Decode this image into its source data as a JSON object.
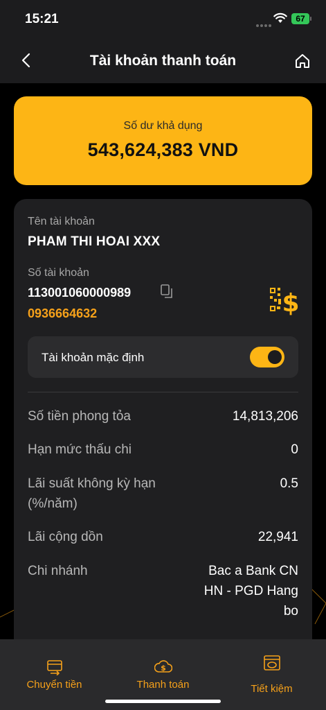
{
  "status_bar": {
    "time": "15:21",
    "battery": "67"
  },
  "header": {
    "title": "Tài khoản thanh toán"
  },
  "balance": {
    "label": "Số dư khả dụng",
    "amount": "543,624,383 VND"
  },
  "account": {
    "name_label": "Tên tài khoản",
    "name": "PHAM THI HOAI XXX",
    "number_label": "Số tài khoản",
    "number": "113001060000989",
    "phone": "0936664632",
    "default_label": "Tài khoản mặc định",
    "default_enabled": true
  },
  "details": [
    {
      "label": "Số tiền phong tỏa",
      "value": "14,813,206"
    },
    {
      "label": "Hạn mức thấu chi",
      "value": "0"
    },
    {
      "label": "Lãi suất không kỳ hạn (%/năm)",
      "value": "0.5"
    },
    {
      "label": "Lãi cộng dồn",
      "value": "22,941"
    },
    {
      "label": "Chi nhánh",
      "value": "Bac a Bank CN HN - PGD Hang bo"
    }
  ],
  "tabs": [
    {
      "label": "Chuyển tiền",
      "icon": "transfer-icon"
    },
    {
      "label": "Thanh toán",
      "icon": "payment-icon"
    },
    {
      "label": "Tiết kiệm",
      "icon": "savings-icon"
    }
  ],
  "colors": {
    "accent": "#fdb515",
    "accent_text": "#f6a11a",
    "background": "#000000",
    "card": "#1f1f21"
  }
}
